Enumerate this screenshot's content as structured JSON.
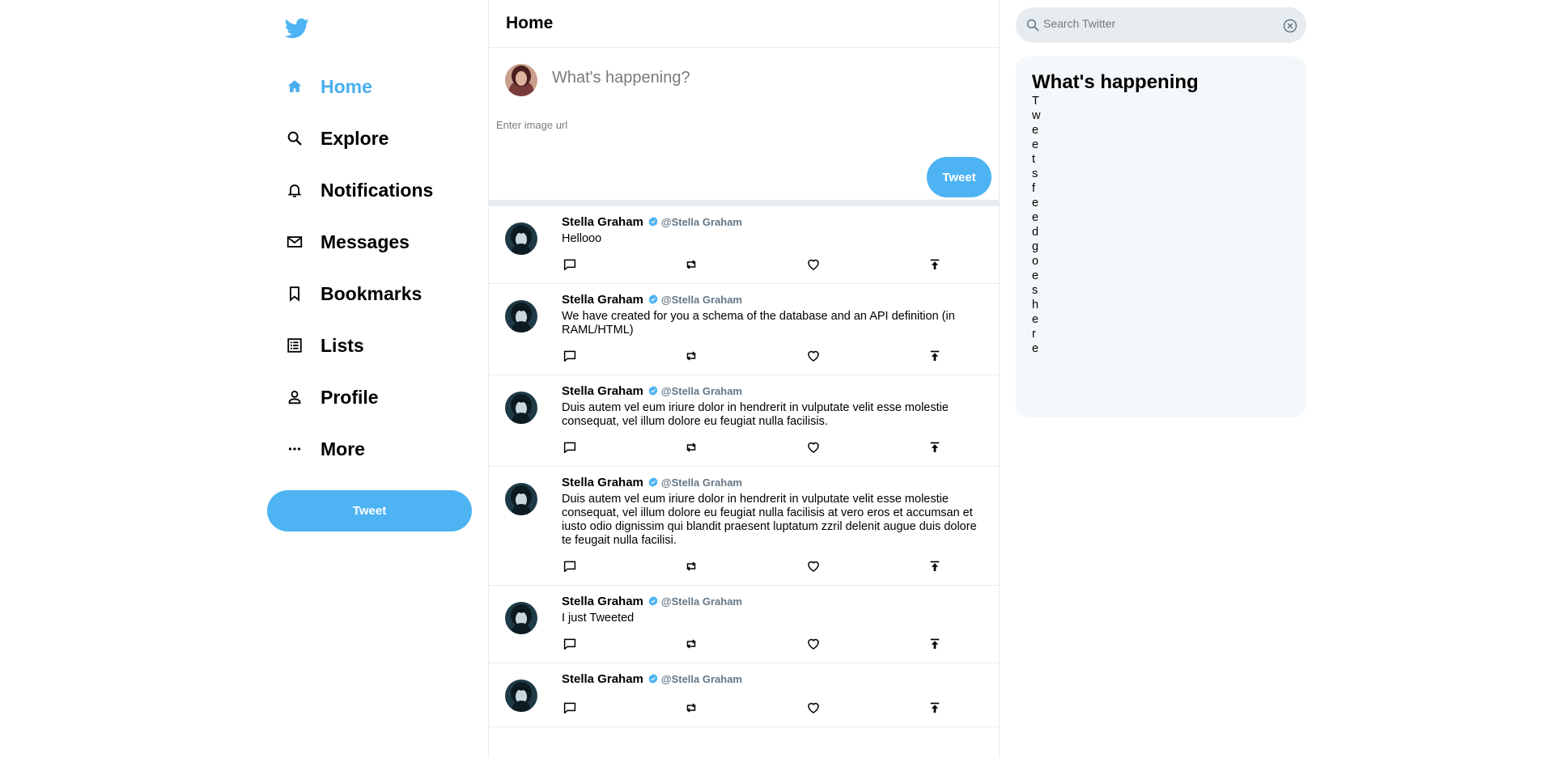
{
  "colors": {
    "accent": "#4db3f3",
    "border": "#e6ecf0",
    "panel": "#f5f8fa",
    "handle": "#657786"
  },
  "sidebar": {
    "logo_icon": "twitter-bird-icon",
    "items": [
      {
        "label": "Home",
        "icon": "home-icon",
        "active": true
      },
      {
        "label": "Explore",
        "icon": "search-icon"
      },
      {
        "label": "Notifications",
        "icon": "bell-icon"
      },
      {
        "label": "Messages",
        "icon": "mail-icon"
      },
      {
        "label": "Bookmarks",
        "icon": "bookmark-icon"
      },
      {
        "label": "Lists",
        "icon": "list-icon"
      },
      {
        "label": "Profile",
        "icon": "person-icon"
      },
      {
        "label": "More",
        "icon": "more-icon"
      }
    ],
    "tweet_button": "Tweet"
  },
  "main": {
    "title": "Home",
    "composer": {
      "placeholder": "What's happening?",
      "image_placeholder": "Enter image url",
      "tweet_button": "Tweet"
    },
    "tweets": [
      {
        "name": "Stella Graham",
        "handle": "@Stella Graham",
        "text": "Hellooo"
      },
      {
        "name": "Stella Graham",
        "handle": "@Stella Graham",
        "text": "We have created for you a schema of the database and an API definition (in RAML/HTML)"
      },
      {
        "name": "Stella Graham",
        "handle": "@Stella Graham",
        "text": "Duis autem vel eum iriure dolor in hendrerit in vulputate velit esse molestie consequat, vel illum dolore eu feugiat nulla facilisis."
      },
      {
        "name": "Stella Graham",
        "handle": "@Stella Graham",
        "text": "Duis autem vel eum iriure dolor in hendrerit in vulputate velit esse molestie consequat, vel illum dolore eu feugiat nulla facilisis at vero eros et accumsan et iusto odio dignissim qui blandit praesent luptatum zzril delenit augue duis dolore te feugait nulla facilisi."
      },
      {
        "name": "Stella Graham",
        "handle": "@Stella Graham",
        "text": "I just Tweeted"
      },
      {
        "name": "Stella Graham",
        "handle": "@Stella Graham",
        "text": ""
      }
    ]
  },
  "right": {
    "search_placeholder": "Search Twitter",
    "trends_title": "What's happening",
    "trends_feed": "Tweets feed goes here"
  }
}
